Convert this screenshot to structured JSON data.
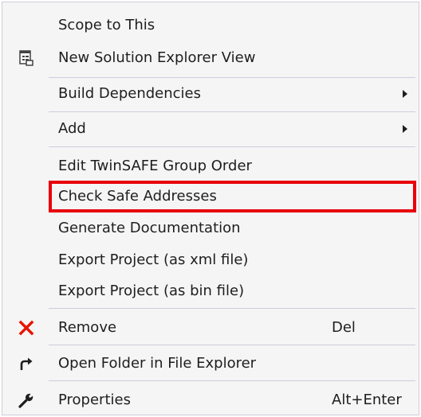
{
  "menu": {
    "items": [
      {
        "label": "Scope to This",
        "icon": "none"
      },
      {
        "label": "New Solution Explorer View",
        "icon": "solution-explorer-icon"
      },
      {
        "label": "Build Dependencies",
        "submenu": true
      },
      {
        "label": "Add",
        "submenu": true
      },
      {
        "label": "Edit TwinSAFE Group Order"
      },
      {
        "label": "Check Safe Addresses",
        "highlighted": true
      },
      {
        "label": "Generate Documentation"
      },
      {
        "label": "Export Project (as xml file)"
      },
      {
        "label": "Export Project (as bin file)"
      },
      {
        "label": "Remove",
        "shortcut": "Del",
        "icon": "remove-x-icon"
      },
      {
        "label": "Open Folder in File Explorer",
        "icon": "open-folder-arrow-icon"
      },
      {
        "label": "Properties",
        "shortcut": "Alt+Enter",
        "icon": "wrench-icon"
      }
    ]
  },
  "colors": {
    "highlight_border": "#e8000b",
    "remove_icon": "#e51400",
    "menu_background": "#f5f5f5",
    "separator": "#cccedb",
    "text": "#1e1e1e"
  }
}
